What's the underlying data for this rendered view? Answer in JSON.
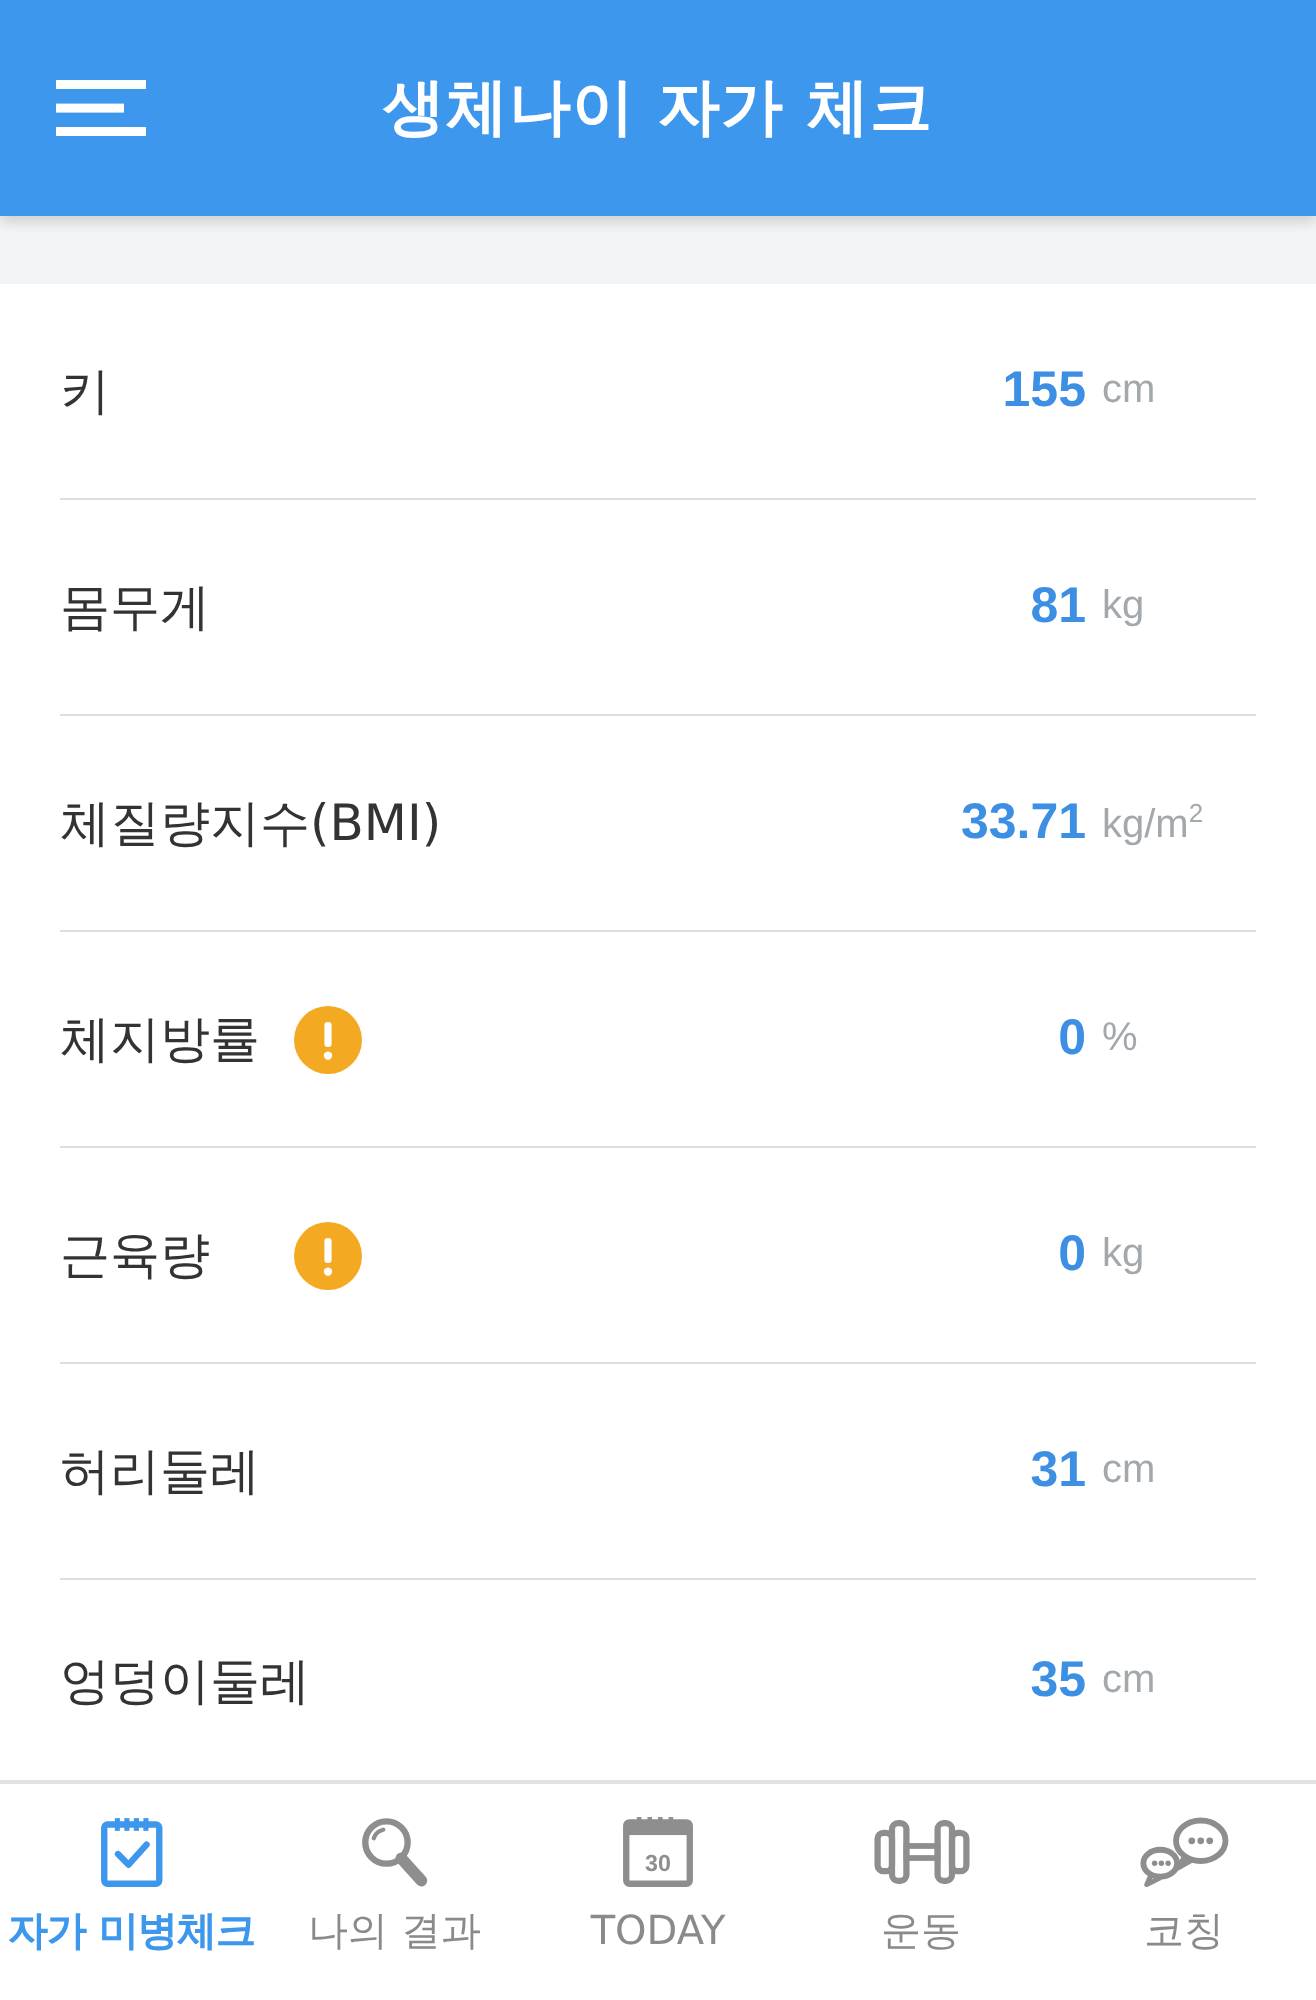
{
  "header": {
    "title": "생체나이 자가 체크"
  },
  "measurements": [
    {
      "label": "키",
      "value": "155",
      "unit": "cm",
      "warning": false
    },
    {
      "label": "몸무게",
      "value": "81",
      "unit": "kg",
      "warning": false
    },
    {
      "label": "체질량지수(BMI)",
      "value": "33.71",
      "unit": "kg/m$^{2}$",
      "warning": false
    },
    {
      "label": "체지방률",
      "value": "0",
      "unit": "%",
      "warning": true
    },
    {
      "label": "근육량",
      "value": "0",
      "unit": "kg",
      "warning": true
    },
    {
      "label": "허리둘레",
      "value": "31",
      "unit": "cm",
      "warning": false
    },
    {
      "label": "엉덩이둘레",
      "value": "35",
      "unit": "cm",
      "warning": false
    }
  ],
  "bottom_nav": [
    {
      "label": "자가 미병체크",
      "kind": "clipboard",
      "selected": true
    },
    {
      "label": "나의 결과",
      "kind": "magnifier",
      "selected": false
    },
    {
      "label": "TODAY",
      "kind": "calendar",
      "icon_text": "30",
      "selected": false
    },
    {
      "label": "운동",
      "kind": "dumbbell",
      "selected": false
    },
    {
      "label": "코칭",
      "kind": "chat",
      "selected": false
    }
  ]
}
